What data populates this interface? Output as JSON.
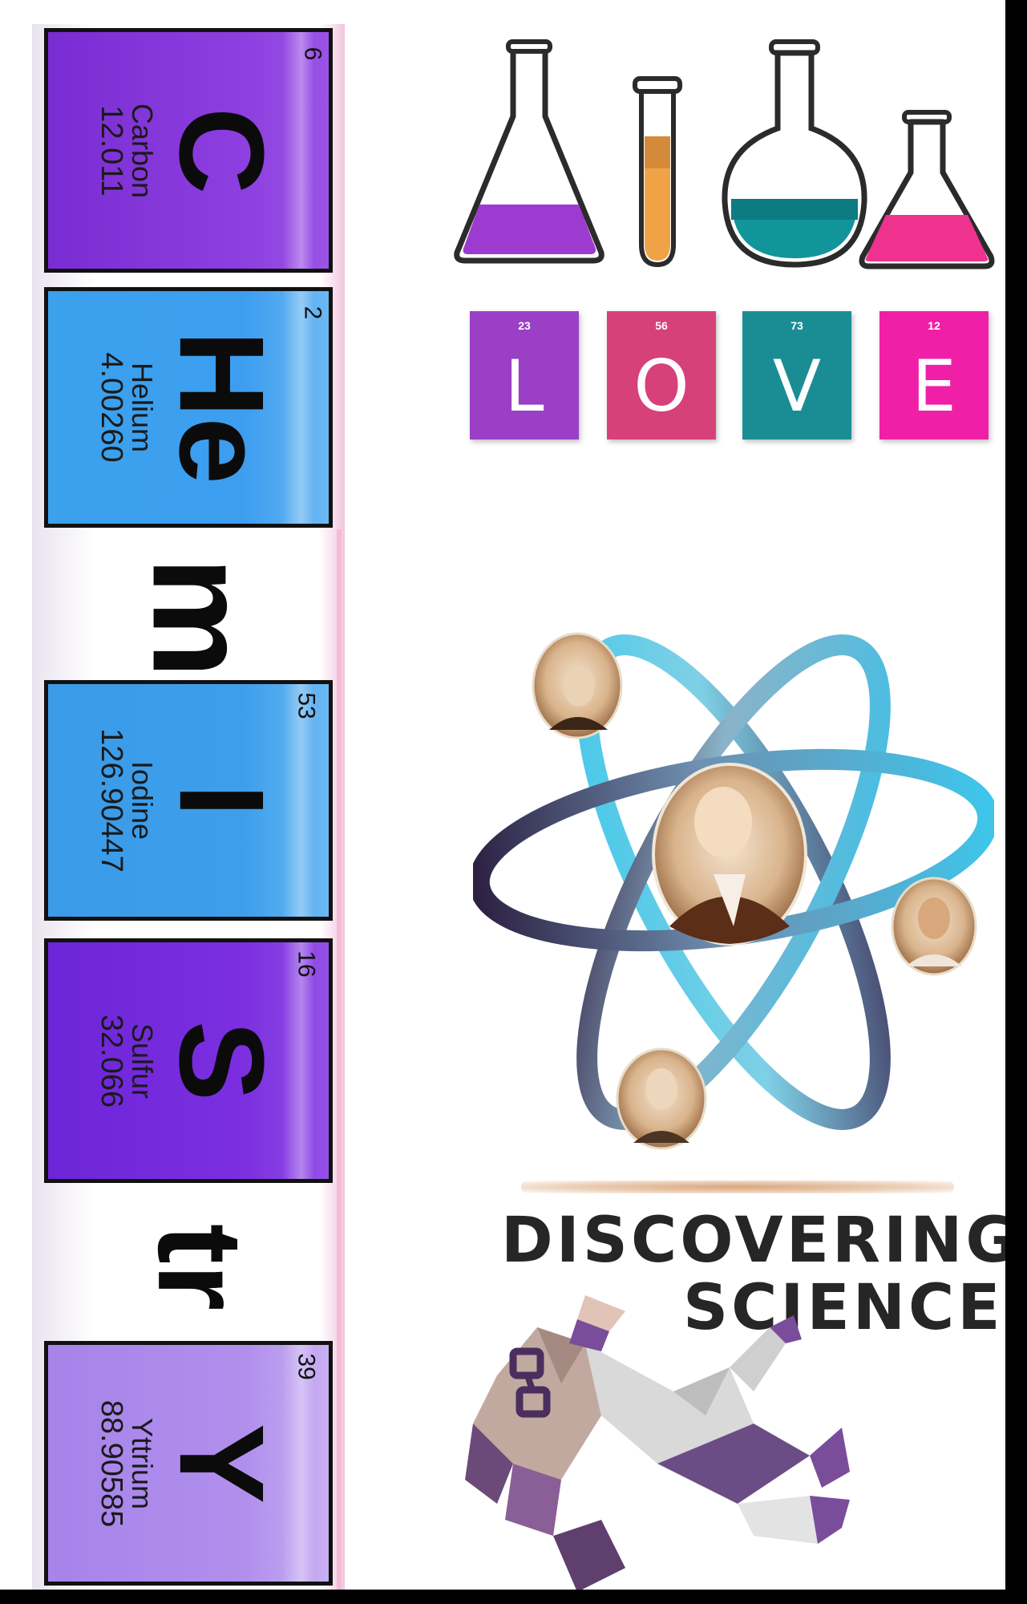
{
  "tiles": [
    {
      "number": "6",
      "symbol": "C",
      "name": "Carbon",
      "mass": "12.011"
    },
    {
      "number": "2",
      "symbol": "He",
      "name": "Helium",
      "mass": "4.00260"
    },
    {
      "number": "53",
      "symbol": "I",
      "name": "Iodine",
      "mass": "126.90447"
    },
    {
      "number": "16",
      "symbol": "S",
      "name": "Sulfur",
      "mass": "32.066"
    },
    {
      "number": "39",
      "symbol": "Y",
      "name": "Yttrium",
      "mass": "88.90585"
    }
  ],
  "letters": [
    "m",
    "tr"
  ],
  "love": [
    {
      "number": "23",
      "letter": "L",
      "color": "#9a3fc6"
    },
    {
      "number": "56",
      "letter": "O",
      "color": "#d6417a"
    },
    {
      "number": "73",
      "letter": "V",
      "color": "#1a8d94"
    },
    {
      "number": "12",
      "letter": "E",
      "color": "#f01fa8"
    }
  ],
  "discovering": {
    "line1": "DISCOVERING",
    "line2": "SCIENCE"
  },
  "colors": {
    "carbon": "#8638d9",
    "helium": "#3aa1ec",
    "iodine": "#3d9fec",
    "sulfur": "#7b2fe0",
    "yttrium": "#b08fec",
    "flask_purple": "#9d3ad0",
    "tube_orange": "#f0a346",
    "flask_teal": "#12959a",
    "flask_pink": "#f0328f"
  }
}
